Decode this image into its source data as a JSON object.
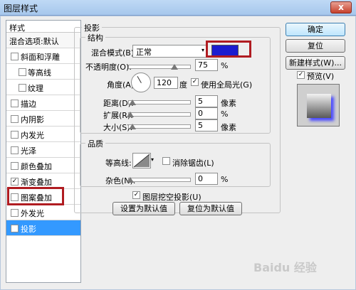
{
  "window": {
    "title": "图层样式",
    "close": "x"
  },
  "styles_panel": {
    "header": "样式",
    "blend": "混合选项:默认",
    "items": [
      {
        "label": "斜面和浮雕",
        "checked": false,
        "sub": false
      },
      {
        "label": "等高线",
        "checked": false,
        "sub": true
      },
      {
        "label": "纹理",
        "checked": false,
        "sub": true
      },
      {
        "label": "描边",
        "checked": false,
        "sub": false
      },
      {
        "label": "内阴影",
        "checked": false,
        "sub": false
      },
      {
        "label": "内发光",
        "checked": false,
        "sub": false
      },
      {
        "label": "光泽",
        "checked": false,
        "sub": false
      },
      {
        "label": "颜色叠加",
        "checked": false,
        "sub": false
      },
      {
        "label": "渐变叠加",
        "checked": true,
        "sub": false
      },
      {
        "label": "图案叠加",
        "checked": false,
        "sub": false
      },
      {
        "label": "外发光",
        "checked": false,
        "sub": false
      },
      {
        "label": "投影",
        "checked": true,
        "sub": false,
        "selected": true
      }
    ]
  },
  "drop_shadow": {
    "title": "投影",
    "structure": {
      "title": "结构",
      "blend_mode_label": "混合模式(B):",
      "blend_mode_value": "正常",
      "shadow_color": "#1c1ccf",
      "opacity_label": "不透明度(O):",
      "opacity_value": "75",
      "opacity_unit": "%",
      "angle_label": "角度(A):",
      "angle_value": "120",
      "angle_unit": "度",
      "global_light_label": "使用全局光(G)",
      "distance_label": "距离(D):",
      "distance_value": "5",
      "distance_unit": "像素",
      "spread_label": "扩展(R):",
      "spread_value": "0",
      "spread_unit": "%",
      "size_label": "大小(S):",
      "size_value": "5",
      "size_unit": "像素"
    },
    "quality": {
      "title": "品质",
      "contour_label": "等高线:",
      "antialias_label": "消除锯齿(L)",
      "noise_label": "杂色(N):",
      "noise_value": "0",
      "noise_unit": "%"
    },
    "knockout_label": "图层挖空投影(U)",
    "make_default": "设置为默认值",
    "reset_default": "复位为默认值"
  },
  "buttons": {
    "ok": "确定",
    "reset": "复位",
    "new_style": "新建样式(W)...",
    "preview": "预览(V)"
  },
  "watermark": "Baidu 经验"
}
